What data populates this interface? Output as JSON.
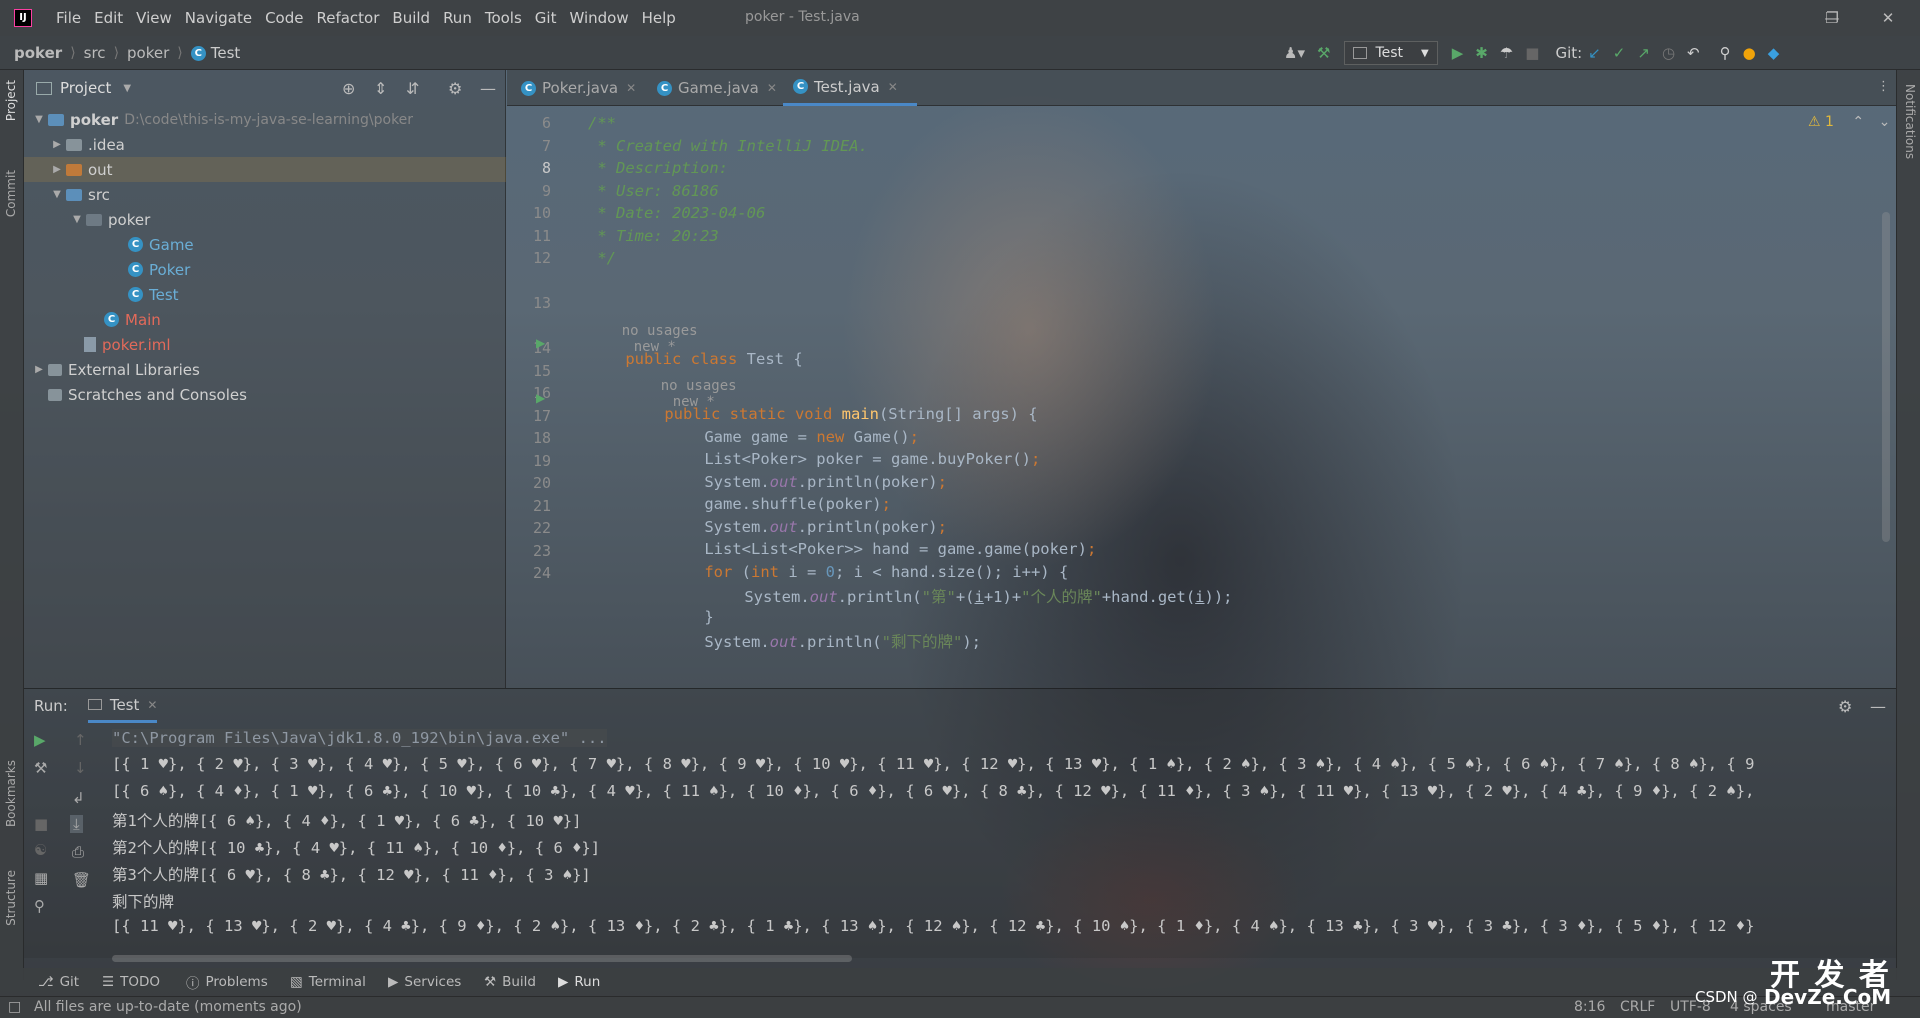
{
  "window": {
    "title": "poker - Test.java",
    "menu": [
      "File",
      "Edit",
      "View",
      "Navigate",
      "Code",
      "Refactor",
      "Build",
      "Run",
      "Tools",
      "Git",
      "Window",
      "Help"
    ],
    "app_logo": "IJ"
  },
  "navbar": {
    "breadcrumbs": [
      "poker",
      "src",
      "poker",
      "Test"
    ],
    "run_config": "Test",
    "git_label": "Git:"
  },
  "project_panel": {
    "title": "Project",
    "tree": [
      {
        "label": "poker",
        "path": "D:\\code\\this-is-my-java-se-learning\\poker"
      },
      {
        "label": ".idea"
      },
      {
        "label": "out"
      },
      {
        "label": "src"
      },
      {
        "label": "poker"
      },
      {
        "label": "Game"
      },
      {
        "label": "Poker"
      },
      {
        "label": "Test"
      },
      {
        "label": "Main"
      },
      {
        "label": "poker.iml"
      },
      {
        "label": "External Libraries"
      },
      {
        "label": "Scratches and Consoles"
      }
    ]
  },
  "side_tabs": {
    "left": [
      "Project",
      "Commit",
      "Bookmarks",
      "Structure"
    ],
    "right": [
      "Notifications"
    ]
  },
  "editor": {
    "tabs": [
      "Poker.java",
      "Game.java",
      "Test.java"
    ],
    "active_tab": "Test.java",
    "warning_count": "1",
    "line_numbers": [
      "6",
      "7",
      "8",
      "9",
      "10",
      "11",
      "12",
      "13",
      "14",
      "15",
      "16",
      "17",
      "18",
      "19",
      "20",
      "21",
      "22",
      "23",
      "24"
    ],
    "hints": {
      "class_usages": "no usages",
      "class_new": "new *",
      "method_usages": "no usages",
      "method_new": "new *"
    },
    "comment_lines": [
      "/**",
      " * Created with IntelliJ IDEA.",
      " * Description:",
      " * User: 86186",
      " * Date: 2023-04-06",
      " * Time: 20:23",
      " */"
    ],
    "code": {
      "l13_kw": "public class ",
      "l13_rest": "Test {",
      "l14_kw": "public static void ",
      "l14_fn": "main",
      "l14_rest": "(String[] args) {",
      "l15_a": "Game game = ",
      "l15_kw": "new ",
      "l15_b": "Game()",
      "l16_a": "List<Poker> poker = game.buyPoker()",
      "l17_a": "System.",
      "l17_out": "out",
      "l17_b": ".println(poker)",
      "l18_a": "game.shuffle(poker)",
      "l19_a": "System.",
      "l19_out": "out",
      "l19_b": ".println(poker)",
      "l20_a": "List<List<Poker>> hand = game.game(poker)",
      "l21_kw1": "for ",
      "l21_a": "(",
      "l21_kw2": "int ",
      "l21_b": "i = ",
      "l21_num": "0",
      "l21_c": "; i < hand.size(); i++) {",
      "l22_a": "System.",
      "l22_out": "out",
      "l22_b": ".println(",
      "l22_s1": "\"第\"",
      "l22_c": "+(",
      "l22_i1": "i",
      "l22_d": "+1)+",
      "l22_s2": "\"个人的牌\"",
      "l22_e": "+hand.get(",
      "l22_i2": "i",
      "l22_f": "));",
      "l23_a": "}",
      "l24_a": "System.",
      "l24_out": "out",
      "l24_b": ".println(",
      "l24_s": "\"剩下的牌\"",
      "l24_c": ");",
      "semi": ";"
    }
  },
  "run_panel": {
    "label": "Run:",
    "tab": "Test",
    "output": [
      "\"C:\\Program Files\\Java\\jdk1.8.0_192\\bin\\java.exe\" ...",
      "[{ 1 ♥}, { 2 ♥}, { 3 ♥}, { 4 ♥}, { 5 ♥}, { 6 ♥}, { 7 ♥}, { 8 ♥}, { 9 ♥}, { 10 ♥}, { 11 ♥}, { 12 ♥}, { 13 ♥}, { 1 ♠}, { 2 ♠}, { 3 ♠}, { 4 ♠}, { 5 ♠}, { 6 ♠}, { 7 ♠}, { 8 ♠}, { 9",
      "[{ 6 ♠}, { 4 ♦}, { 1 ♥}, { 6 ♣}, { 10 ♥}, { 10 ♣}, { 4 ♥}, { 11 ♠}, { 10 ♦}, { 6 ♦}, { 6 ♥}, { 8 ♣}, { 12 ♥}, { 11 ♦}, { 3 ♠}, { 11 ♥}, { 13 ♥}, { 2 ♥}, { 4 ♣}, { 9 ♦}, { 2 ♠},",
      "第1个人的牌[{ 6 ♠}, { 4 ♦}, { 1 ♥}, { 6 ♣}, { 10 ♥}]",
      "第2个人的牌[{ 10 ♣}, { 4 ♥}, { 11 ♠}, { 10 ♦}, { 6 ♦}]",
      "第3个人的牌[{ 6 ♥}, { 8 ♣}, { 12 ♥}, { 11 ♦}, { 3 ♠}]",
      "剩下的牌",
      "[{ 11 ♥}, { 13 ♥}, { 2 ♥}, { 4 ♣}, { 9 ♦}, { 2 ♠}, { 13 ♦}, { 2 ♣}, { 1 ♣}, { 13 ♠}, { 12 ♠}, { 12 ♣}, { 10 ♠}, { 1 ♦}, { 4 ♠}, { 13 ♣}, { 3 ♥}, { 3 ♣}, { 3 ♦}, { 5 ♦}, { 12 ♦}"
    ]
  },
  "tool_windows": [
    "Git",
    "TODO",
    "Problems",
    "Terminal",
    "Services",
    "Build",
    "Run"
  ],
  "status": {
    "message": "All files are up-to-date (moments ago)",
    "position": "8:16",
    "line_sep": "CRLF",
    "encoding": "UTF-8",
    "indent": "4 spaces",
    "branch": "master"
  },
  "watermark": {
    "csdn": "CSDN @",
    "site_cn": "开 发 者",
    "site": "DevZe.CoM"
  }
}
